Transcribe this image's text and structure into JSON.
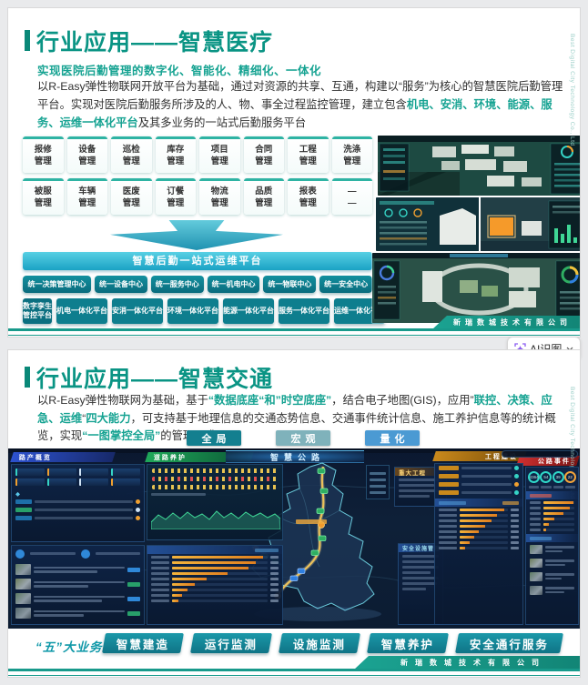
{
  "ai_tool": {
    "label": "AI识图"
  },
  "footer_company": "新瑞数城技术有限公司",
  "side_note": "Best Digital City Technology Co., Ltd",
  "slide1": {
    "title": "行业应用——智慧医疗",
    "subtitle": "实现医院后勤管理的数字化、智能化、精细化、一体化",
    "body": {
      "seg1": "以R-Easy弹性物联网开放平台为基础，通过对资源的共享、互通，构建以“服务”为核心的智慧医院后勤管理平台。实现对医院后勤服务所涉及的人、物、事全过程监控管理，建立包含",
      "highlight": "机电、安消、环境、能源、服务、运维一体化平台",
      "seg2": "及其多业务的一站式后勤服务平台"
    },
    "modules_row1": [
      {
        "l1": "报修",
        "l2": "管理"
      },
      {
        "l1": "设备",
        "l2": "管理"
      },
      {
        "l1": "巡检",
        "l2": "管理"
      },
      {
        "l1": "库存",
        "l2": "管理"
      },
      {
        "l1": "项目",
        "l2": "管理"
      },
      {
        "l1": "合同",
        "l2": "管理"
      },
      {
        "l1": "工程",
        "l2": "管理"
      },
      {
        "l1": "洗涤",
        "l2": "管理"
      }
    ],
    "modules_row2": [
      {
        "l1": "被服",
        "l2": "管理"
      },
      {
        "l1": "车辆",
        "l2": "管理"
      },
      {
        "l1": "医废",
        "l2": "管理"
      },
      {
        "l1": "订餐",
        "l2": "管理"
      },
      {
        "l1": "物流",
        "l2": "管理"
      },
      {
        "l1": "品质",
        "l2": "管理"
      },
      {
        "l1": "报表",
        "l2": "管理"
      },
      {
        "l1": "—",
        "l2": "—"
      }
    ],
    "platform_bar": "智慧后勤一站式运维平台",
    "centers": [
      "统一决策管理中心",
      "统一设备中心",
      "统一服务中心",
      "统一机电中心",
      "统一物联中心",
      "统一安全中心"
    ],
    "platform_first": {
      "l1": "数字孪生",
      "l2": "管控平台"
    },
    "platforms": [
      "机电一体化平台",
      "安消一体化平台",
      "环境一体化平台",
      "能源一体化平台",
      "服务一体化平台",
      "运维一体化平台"
    ]
  },
  "slide2": {
    "title": "行业应用——智慧交通",
    "body": {
      "b1": "以R-Easy弹性物联网为基础，基于",
      "t1": "“数据底座“和”时空底座”",
      "b2": "，结合电子地图(GIS)，应用”",
      "t2": "联控、决策、应急、运维",
      "b3": "“",
      "t3": "四大能力",
      "b4": "，可支持基于地理信息的交通态势信息、交通事件统计信息、施工养护信息等的统计概览，实现",
      "t4": "“一图掌控全局”",
      "b5": "的管理要求."
    },
    "view_buttons": [
      "全局",
      "宏观",
      "量化"
    ],
    "dashboard": {
      "banner": "智慧公路",
      "ribbons": [
        "路产概览",
        "道路养护",
        "工程建设",
        "公路事件"
      ],
      "major_panel": "重大工程",
      "safety_panel": "安全设施管理",
      "gauges": [
        "4364",
        "54",
        "39",
        "22"
      ]
    },
    "biz_label": "“五”大业务应用",
    "biz_buttons": [
      "智慧建造",
      "运行监测",
      "设施监测",
      "智慧养护",
      "安全通行服务"
    ]
  }
}
